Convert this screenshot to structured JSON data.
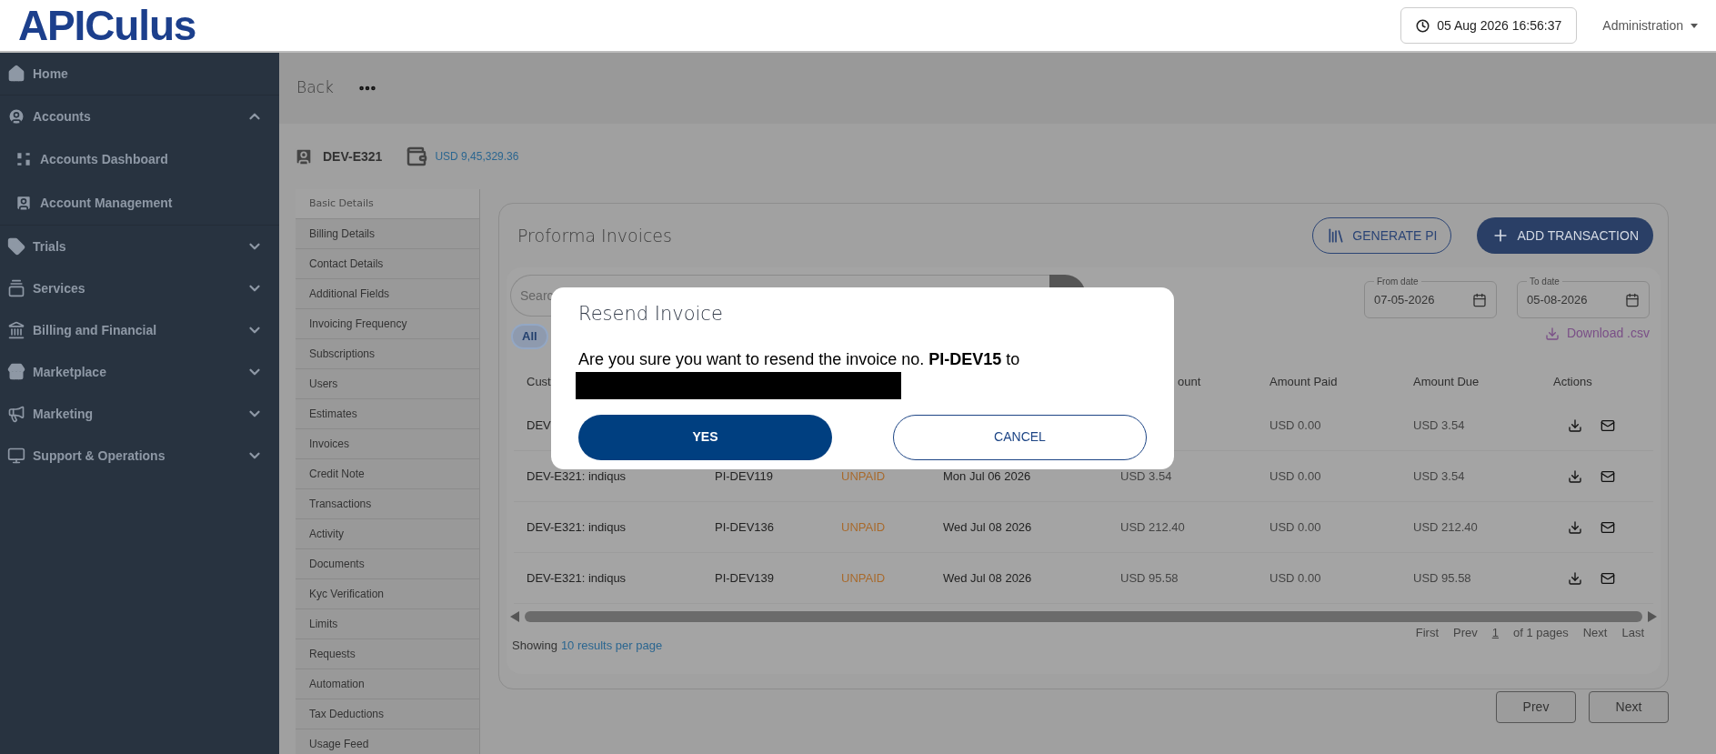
{
  "header": {
    "logo": "APICulus",
    "clock": "05 Aug 2026 16:56:37",
    "menu": "Administration"
  },
  "sidebar": {
    "items": [
      {
        "label": "Home"
      },
      {
        "label": "Accounts",
        "expanded": true,
        "children": [
          {
            "label": "Accounts Dashboard"
          },
          {
            "label": "Account Management"
          }
        ]
      },
      {
        "label": "Trials",
        "expanded": false
      },
      {
        "label": "Services",
        "expanded": false
      },
      {
        "label": "Billing and Financial",
        "expanded": false
      },
      {
        "label": "Marketplace",
        "expanded": false
      },
      {
        "label": "Marketing",
        "expanded": false
      },
      {
        "label": "Support & Operations",
        "expanded": false
      }
    ]
  },
  "back": "Back",
  "account": {
    "id": "DEV-E321",
    "balance": "USD 9,45,329.36"
  },
  "submenu": [
    {
      "label": "Basic Details",
      "selected": true
    },
    {
      "label": "Billing Details",
      "selected": false
    },
    {
      "label": "Contact Details",
      "selected": false
    },
    {
      "label": "Additional Fields",
      "selected": false
    },
    {
      "label": "Invoicing Frequency",
      "selected": false
    },
    {
      "label": "Subscriptions",
      "selected": false
    },
    {
      "label": "Users",
      "selected": false
    },
    {
      "label": "Estimates",
      "selected": false
    },
    {
      "label": "Invoices",
      "selected": false
    },
    {
      "label": "Credit Note",
      "selected": false
    },
    {
      "label": "Transactions",
      "selected": false
    },
    {
      "label": "Activity",
      "selected": false
    },
    {
      "label": "Documents",
      "selected": false
    },
    {
      "label": "Kyc Verification",
      "selected": false
    },
    {
      "label": "Limits",
      "selected": false
    },
    {
      "label": "Requests",
      "selected": false
    },
    {
      "label": "Automation",
      "selected": false
    },
    {
      "label": "Tax Deductions",
      "selected": false
    },
    {
      "label": "Usage Feed",
      "selected": false
    }
  ],
  "card": {
    "title": "Proforma Invoices",
    "buttons": [
      {
        "label": "GENERATE PI",
        "kind": "outline"
      },
      {
        "label": "ADD TRANSACTION",
        "kind": "filled"
      }
    ],
    "search": {
      "placeholder": "Searc"
    },
    "filters": [
      {
        "label": "All",
        "selected": true
      }
    ],
    "from_date": {
      "label": "From date",
      "value": "07-05-2026"
    },
    "to_date": {
      "label": "To date",
      "value": "05-08-2026"
    },
    "download": "Download .csv",
    "table": {
      "columns": [
        "Cust",
        null,
        null,
        null,
        "ount",
        "Amount Paid",
        "Amount Due",
        "Actions"
      ],
      "rows": [
        [
          "DEV",
          null,
          null,
          null,
          null,
          "USD 0.00",
          "USD 3.54"
        ],
        [
          "DEV-E321: indiqus",
          "PI-DEV119",
          "UNPAID",
          "Mon Jul 06 2026",
          "USD 3.54",
          "USD 0.00",
          "USD 3.54"
        ],
        [
          "DEV-E321: indiqus",
          "PI-DEV136",
          "UNPAID",
          "Wed Jul 08 2026",
          "USD 212.40",
          "USD 0.00",
          "USD 212.40"
        ],
        [
          "DEV-E321: indiqus",
          "PI-DEV139",
          "UNPAID",
          "Wed Jul 08 2026",
          "USD 95.58",
          "USD 0.00",
          "USD 95.58"
        ]
      ]
    },
    "showing": "Showing",
    "per_page": "10 results per page",
    "pagination": [
      {
        "label": "First",
        "selected": false
      },
      {
        "label": "Prev",
        "selected": false
      },
      {
        "label": "1",
        "selected": true
      },
      {
        "label": "of 1 pages",
        "selected": false
      },
      {
        "label": "Next",
        "selected": false
      },
      {
        "label": "Last",
        "selected": false
      }
    ]
  },
  "pager_buttons": [
    "Prev",
    "Next"
  ],
  "dialog": {
    "title": "Resend Invoice",
    "message": "Are you sure you want to resend the invoice no. **PI-DEV15** to",
    "buttons": [
      {
        "label": "YES",
        "kind": "primary"
      },
      {
        "label": "CANCEL",
        "kind": "secondary"
      }
    ]
  }
}
